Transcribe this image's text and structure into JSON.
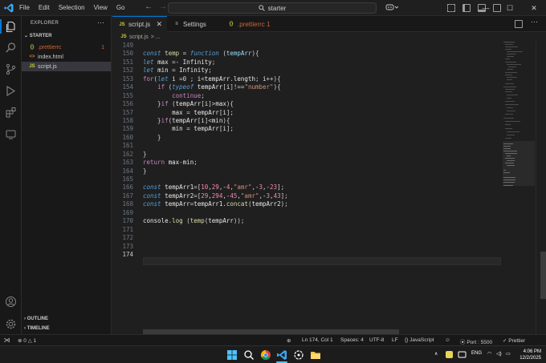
{
  "menu": [
    "File",
    "Edit",
    "Selection",
    "View",
    "Go"
  ],
  "search": {
    "text": "starter"
  },
  "sidebar": {
    "title": "EXPLORER",
    "folder": "STARTER",
    "files": [
      {
        "icon": "{}",
        "name": ".prettierrc",
        "badge": "1"
      },
      {
        "icon": "<>",
        "name": "index.html",
        "badge": ""
      },
      {
        "icon": "JS",
        "name": "script.js",
        "badge": ""
      }
    ],
    "outline": "OUTLINE",
    "timeline": "TIMELINE"
  },
  "tabs": [
    {
      "icon": "JS",
      "label": "script.js"
    },
    {
      "icon": "≡",
      "label": "Settings"
    },
    {
      "icon": "{}",
      "label": ".prettierrc 1"
    }
  ],
  "breadcrumb": {
    "icon": "JS",
    "file": "script.js",
    "rest": "> ..."
  },
  "editor": {
    "line_numbers": [
      "149",
      "150",
      "151",
      "152",
      "153",
      "154",
      "155",
      "156",
      "157",
      "158",
      "159",
      "160",
      "161",
      "162",
      "163",
      "164",
      "165",
      "166",
      "167",
      "168",
      "169",
      "170",
      "171",
      "172",
      "173",
      "174"
    ],
    "current_line": "174",
    "code": [
      [],
      [
        [
          "st",
          "const "
        ],
        [
          "fn",
          "temp"
        ],
        [
          "op",
          " = "
        ],
        [
          "st",
          "function "
        ],
        [
          "op",
          "("
        ],
        [
          "ac",
          "tempArr"
        ],
        [
          "op",
          "){"
        ]
      ],
      [
        [
          "st",
          "let "
        ],
        [
          "id",
          "max "
        ],
        [
          "op",
          "=- "
        ],
        [
          "id",
          "Infinity"
        ],
        [
          "op",
          ";"
        ]
      ],
      [
        [
          "st",
          "let "
        ],
        [
          "id",
          "min "
        ],
        [
          "op",
          "= "
        ],
        [
          "id",
          "Infinity"
        ],
        [
          "op",
          ";"
        ]
      ],
      [
        [
          "kw",
          "for"
        ],
        [
          "op",
          "("
        ],
        [
          "st",
          "let "
        ],
        [
          "id",
          "i "
        ],
        [
          "op",
          "=0 ; "
        ],
        [
          "id",
          "i"
        ],
        [
          "op",
          "<"
        ],
        [
          "id",
          "tempArr"
        ],
        [
          "op",
          "."
        ],
        [
          "id",
          "length"
        ],
        [
          "op",
          "; "
        ],
        [
          "id",
          "i"
        ],
        [
          "op",
          "++){"
        ]
      ],
      [
        [
          "op",
          "    "
        ],
        [
          "kw",
          "if "
        ],
        [
          "op",
          "("
        ],
        [
          "st",
          "typeof "
        ],
        [
          "id",
          "tempArr"
        ],
        [
          "op",
          "["
        ],
        [
          "id",
          "i"
        ],
        [
          "op",
          "]!=="
        ],
        [
          "s",
          "\"number\""
        ],
        [
          "op",
          "){"
        ]
      ],
      [
        [
          "op",
          "        "
        ],
        [
          "kw",
          "continue"
        ],
        [
          "op",
          ";"
        ]
      ],
      [
        [
          "op",
          "    }"
        ],
        [
          "kw",
          "if "
        ],
        [
          "op",
          "("
        ],
        [
          "id",
          "tempArr"
        ],
        [
          "op",
          "["
        ],
        [
          "id",
          "i"
        ],
        [
          "op",
          "]>"
        ],
        [
          "id",
          "max"
        ],
        [
          "op",
          "){"
        ]
      ],
      [
        [
          "op",
          "        "
        ],
        [
          "id",
          "max "
        ],
        [
          "op",
          "= "
        ],
        [
          "id",
          "tempArr"
        ],
        [
          "op",
          "["
        ],
        [
          "id",
          "i"
        ],
        [
          "op",
          "];"
        ]
      ],
      [
        [
          "op",
          "    }"
        ],
        [
          "kw",
          "if"
        ],
        [
          "op",
          "("
        ],
        [
          "id",
          "tempArr"
        ],
        [
          "op",
          "["
        ],
        [
          "id",
          "i"
        ],
        [
          "op",
          "]<"
        ],
        [
          "id",
          "min"
        ],
        [
          "op",
          "){"
        ]
      ],
      [
        [
          "op",
          "        "
        ],
        [
          "id",
          "min "
        ],
        [
          "op",
          "= "
        ],
        [
          "id",
          "tempArr"
        ],
        [
          "op",
          "["
        ],
        [
          "id",
          "i"
        ],
        [
          "op",
          "];"
        ]
      ],
      [
        [
          "op",
          "    }"
        ]
      ],
      [],
      [
        [
          "op",
          "}"
        ]
      ],
      [
        [
          "kw",
          "return "
        ],
        [
          "id",
          "max"
        ],
        [
          "op",
          "-"
        ],
        [
          "id",
          "min"
        ],
        [
          "op",
          ";"
        ]
      ],
      [
        [
          "op",
          "}"
        ]
      ],
      [],
      [
        [
          "st",
          "const "
        ],
        [
          "id",
          "tempArr1"
        ],
        [
          "op",
          "=["
        ],
        [
          "nm",
          "10"
        ],
        [
          "op",
          ","
        ],
        [
          "nm",
          "29"
        ],
        [
          "op",
          ",-"
        ],
        [
          "nm",
          "4"
        ],
        [
          "op",
          ","
        ],
        [
          "s",
          "\"amr\""
        ],
        [
          "op",
          ",-"
        ],
        [
          "nm",
          "3"
        ],
        [
          "op",
          ",-"
        ],
        [
          "nm",
          "23"
        ],
        [
          "op",
          "];"
        ]
      ],
      [
        [
          "st",
          "const "
        ],
        [
          "id",
          "tempArr2"
        ],
        [
          "op",
          "=["
        ],
        [
          "nm",
          "29"
        ],
        [
          "op",
          ","
        ],
        [
          "nm",
          "294"
        ],
        [
          "op",
          ",-"
        ],
        [
          "nm",
          "45"
        ],
        [
          "op",
          ","
        ],
        [
          "s",
          "\"amr\""
        ],
        [
          "op",
          ",-"
        ],
        [
          "nm",
          "3"
        ],
        [
          "op",
          ","
        ],
        [
          "nm",
          "43"
        ],
        [
          "op",
          "];"
        ]
      ],
      [
        [
          "st",
          "const "
        ],
        [
          "id",
          "tempArr"
        ],
        [
          "op",
          "="
        ],
        [
          "id",
          "tempArr1"
        ],
        [
          "op",
          "."
        ],
        [
          "fn",
          "concat"
        ],
        [
          "op",
          "("
        ],
        [
          "id",
          "tempArr2"
        ],
        [
          "op",
          ");"
        ]
      ],
      [],
      [
        [
          "id",
          "console"
        ],
        [
          "op",
          "."
        ],
        [
          "fn",
          "log "
        ],
        [
          "op",
          "("
        ],
        [
          "fn",
          "temp"
        ],
        [
          "op",
          "("
        ],
        [
          "id",
          "tempArr"
        ],
        [
          "op",
          "));"
        ]
      ],
      [],
      [],
      [],
      []
    ]
  },
  "status": {
    "problems": "0",
    "warnings": "1",
    "position": "Ln 174, Col 1",
    "spaces": "Spaces: 4",
    "encoding": "UTF-8",
    "eol": "LF",
    "language": "JavaScript",
    "port": "Port : 5500",
    "formatter": "Prettier"
  },
  "taskbar": {
    "lang": "ENG",
    "time": "4:06 PM",
    "date": "12/2/2025"
  },
  "colors": {
    "accent": "#0078d4",
    "js": "#cbcb41",
    "json": "#cbcb41",
    "html": "#e37933",
    "badge": "#cc6633"
  }
}
